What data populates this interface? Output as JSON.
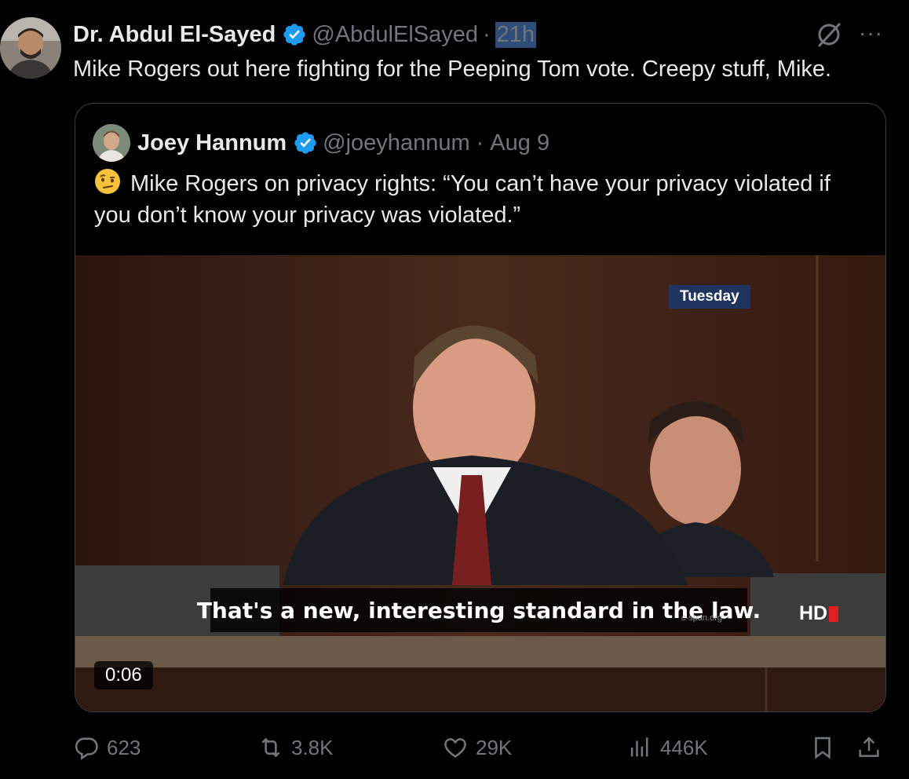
{
  "tweet": {
    "author_name": "Dr. Abdul El-Sayed",
    "handle": "@AbdulElSayed",
    "separator": "·",
    "time": "21h",
    "text": "Mike Rogers out here fighting for the Peeping Tom vote. Creepy stuff, Mike.",
    "more": "···"
  },
  "quote": {
    "author_name": "Joey Hannum",
    "handle": "@joeyhannum",
    "separator": "·",
    "time": "Aug 9",
    "emoji": "face-with-raised-eyebrow",
    "text": "Mike Rogers on privacy rights: “You can’t have your privacy violated if you don’t know your privacy was violated.”"
  },
  "video": {
    "tag": "Tuesday",
    "subtitle": "That's a new, interesting standard in the law.",
    "hd": "HD",
    "watermark": "c-span.org",
    "duration": "0:06"
  },
  "actions": {
    "replies": "623",
    "reposts": "3.8K",
    "likes": "29K",
    "views": "446K"
  },
  "colors": {
    "background": "#000000",
    "text": "#e7e9ea",
    "muted": "#71767b",
    "verified": "#1d9bf0",
    "border": "#3a3d41"
  }
}
